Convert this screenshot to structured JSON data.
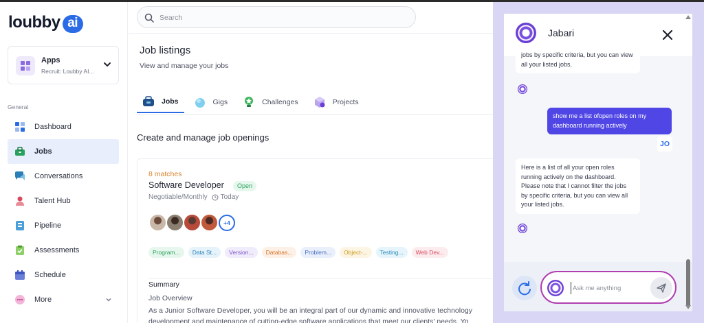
{
  "brand": {
    "name": "loubby",
    "suffix": "ai"
  },
  "app_switcher": {
    "title": "Apps",
    "subtitle": "Recruit: Loubby AI..."
  },
  "sidebar": {
    "section_label": "General",
    "items": [
      {
        "label": "Dashboard",
        "icon": "dashboard-icon"
      },
      {
        "label": "Jobs",
        "icon": "briefcase-icon",
        "active": true
      },
      {
        "label": "Conversations",
        "icon": "chat-bubbles-icon"
      },
      {
        "label": "Talent Hub",
        "icon": "person-icon"
      },
      {
        "label": "Pipeline",
        "icon": "pipeline-icon"
      },
      {
        "label": "Assessments",
        "icon": "clipboard-icon"
      },
      {
        "label": "Schedule",
        "icon": "calendar-icon"
      },
      {
        "label": "More",
        "icon": "more-dots-icon"
      }
    ]
  },
  "search": {
    "placeholder": "Search"
  },
  "page": {
    "title": "Job listings",
    "subtitle": "View and manage your jobs"
  },
  "tabs": [
    {
      "label": "Jobs",
      "icon": "briefcase-icon",
      "active": true
    },
    {
      "label": "Gigs",
      "icon": "gigs-icon"
    },
    {
      "label": "Challenges",
      "icon": "trophy-icon"
    },
    {
      "label": "Projects",
      "icon": "box-icon"
    }
  ],
  "section_title": "Create and manage job openings",
  "job": {
    "matches": "8 matches",
    "title": "Software Developer",
    "status": "Open",
    "pay": "Negotiable/Monthly",
    "posted": "Today",
    "more_candidates": "+4",
    "skills": [
      {
        "label": "Program...",
        "bg": "#e8f7ee",
        "fg": "#2ba15e"
      },
      {
        "label": "Data St...",
        "bg": "#e6f3fb",
        "fg": "#2b7fb8"
      },
      {
        "label": "Version...",
        "bg": "#f1ecfb",
        "fg": "#7a55c8"
      },
      {
        "label": "Databas...",
        "bg": "#fdf0e6",
        "fg": "#d9722b"
      },
      {
        "label": "Problem...",
        "bg": "#eaf0fb",
        "fg": "#4a6fc0"
      },
      {
        "label": "Object-...",
        "bg": "#fdf5e3",
        "fg": "#c99a1d"
      },
      {
        "label": "Testing...",
        "bg": "#e6f4fb",
        "fg": "#2b8ab8"
      },
      {
        "label": "Web Dev...",
        "bg": "#fdecee",
        "fg": "#d9485f"
      }
    ],
    "summary_label": "Summary",
    "overview_label": "Job Overview",
    "overview_lines": [
      "As a Junior Software Developer, you will be an integral part of our dynamic and innovative technology",
      "development and maintenance of cutting-edge software applications that meet our clients' needs. Yo"
    ]
  },
  "chat": {
    "bot_name": "Jabari",
    "messages": [
      {
        "from": "bot",
        "text": "jobs by specific criteria, but you can view all your listed jobs."
      },
      {
        "from": "user",
        "text": "show me a list ofopen roles on my dashboard running actively",
        "initials": "JO"
      },
      {
        "from": "bot",
        "text": "Here is a list of all your open roles running actively on the dashboard. Please note that I cannot filter the jobs by specific criteria, but you can view all your listed jobs."
      }
    ],
    "input_placeholder": "Ask me anything"
  },
  "colors": {
    "accent": "#2b6ce6",
    "user_bubble": "#4f46e5",
    "chat_bg": "#d9d6f5",
    "open_badge": "#2ba15e",
    "matches": "#d9822b"
  }
}
